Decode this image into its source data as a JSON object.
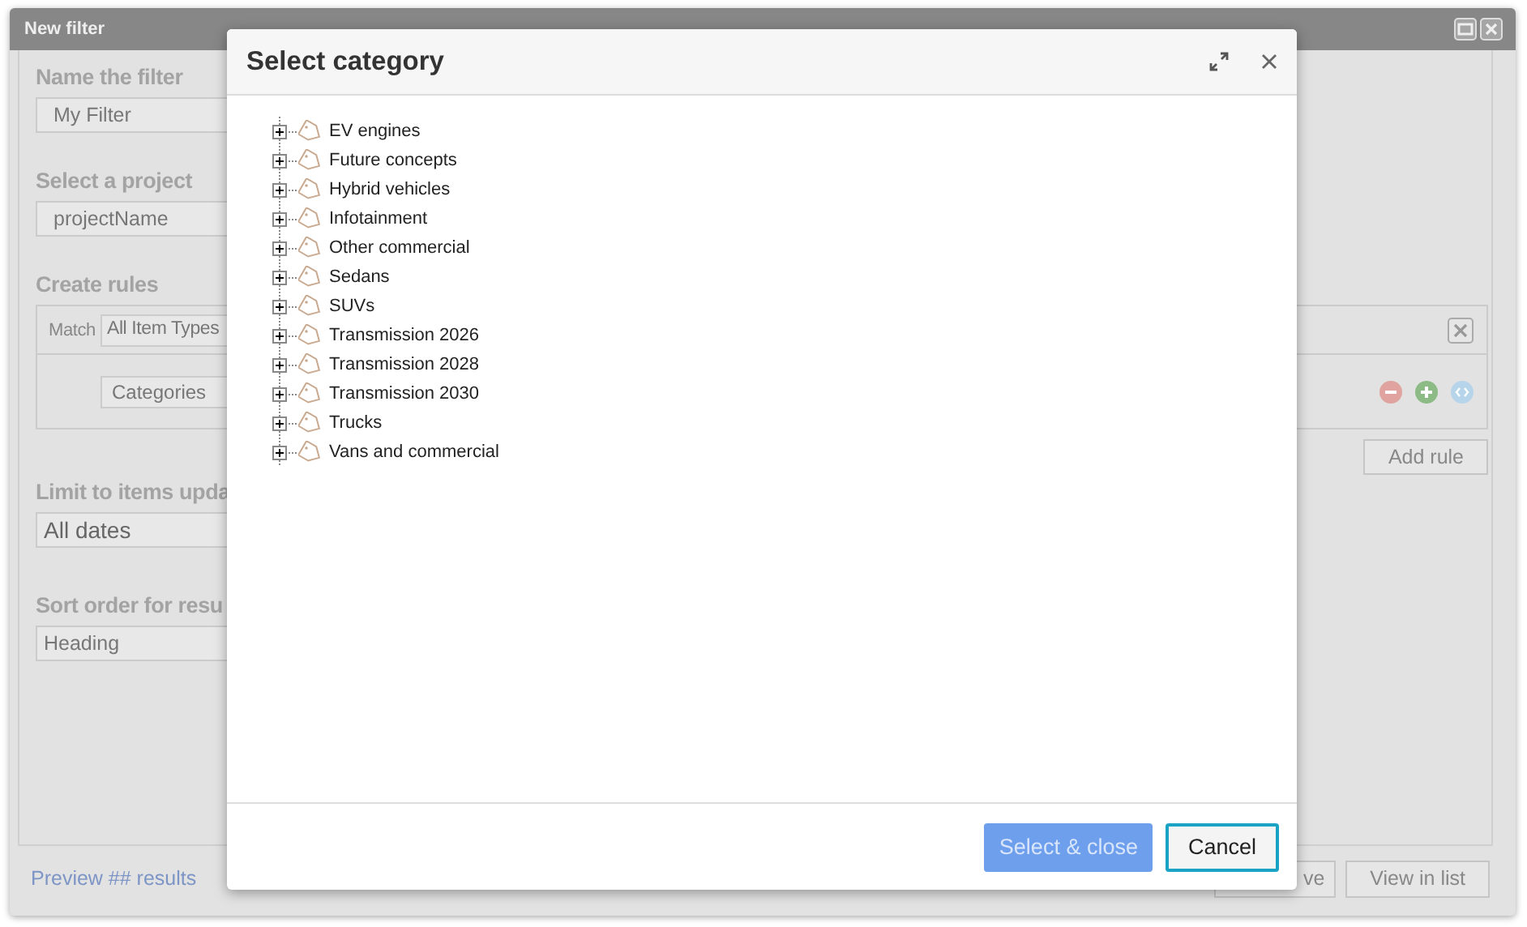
{
  "window": {
    "title": "New filter"
  },
  "form": {
    "name_label": "Name the filter",
    "name_value": "My Filter",
    "project_label": "Select a project",
    "project_value": "projectName",
    "rules_label": "Create rules",
    "rule": {
      "match_label": "Match",
      "item_type": "All Item Types",
      "field": "Categories"
    },
    "add_rule": "Add rule",
    "limit_label": "Limit to items upda",
    "limit_value": "All dates",
    "sort_label": "Sort order for resu",
    "sort_value": "Heading"
  },
  "footer": {
    "preview_link": "Preview ## results",
    "buttons": [
      "ve",
      "View in list"
    ]
  },
  "dialog": {
    "title": "Select category",
    "categories": [
      {
        "label": "EV engines",
        "expanded": false
      },
      {
        "label": "Future concepts",
        "expanded": false
      },
      {
        "label": "Hybrid vehicles",
        "expanded": false
      },
      {
        "label": "Infotainment",
        "expanded": false
      },
      {
        "label": "Other commercial",
        "expanded": false
      },
      {
        "label": "Sedans",
        "expanded": false
      },
      {
        "label": "SUVs",
        "expanded": false
      },
      {
        "label": "Transmission 2026",
        "expanded": false
      },
      {
        "label": "Transmission 2028",
        "expanded": false
      },
      {
        "label": "Transmission 2030",
        "expanded": false
      },
      {
        "label": "Trucks",
        "expanded": false
      },
      {
        "label": "Vans and commercial",
        "expanded": false
      }
    ],
    "buttons": [
      {
        "label": "Select & close",
        "kind": "primary",
        "disabled": true,
        "focused": false
      },
      {
        "label": "Cancel",
        "kind": "secondary",
        "disabled": false,
        "focused": true
      }
    ]
  }
}
